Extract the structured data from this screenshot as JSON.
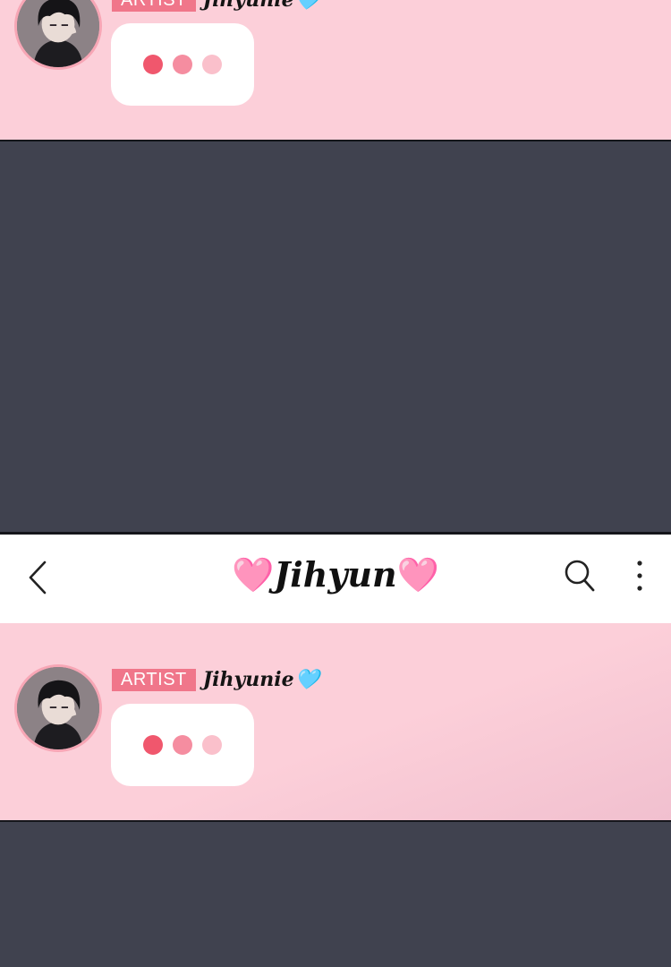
{
  "header": {
    "title_left_heart": "🩷",
    "title": "Jihyun",
    "title_right_heart": "🩷",
    "icons": [
      "chevron-left-icon",
      "search-icon",
      "more-vertical-icon"
    ]
  },
  "messages": [
    {
      "badge": "ARTIST",
      "username": "Jihyunie",
      "username_heart": "🩵",
      "typing_dots": 3
    },
    {
      "badge": "ARTIST",
      "username": "Jihyunie",
      "username_heart": "🩵",
      "typing_dots": 3
    }
  ],
  "colors": {
    "chat_background": "#fccfd9",
    "page_background": "#40424f",
    "badge": "#f0768a",
    "dot_1": "#f0576d",
    "dot_2": "#f58da0",
    "dot_3": "#fac0cb"
  }
}
